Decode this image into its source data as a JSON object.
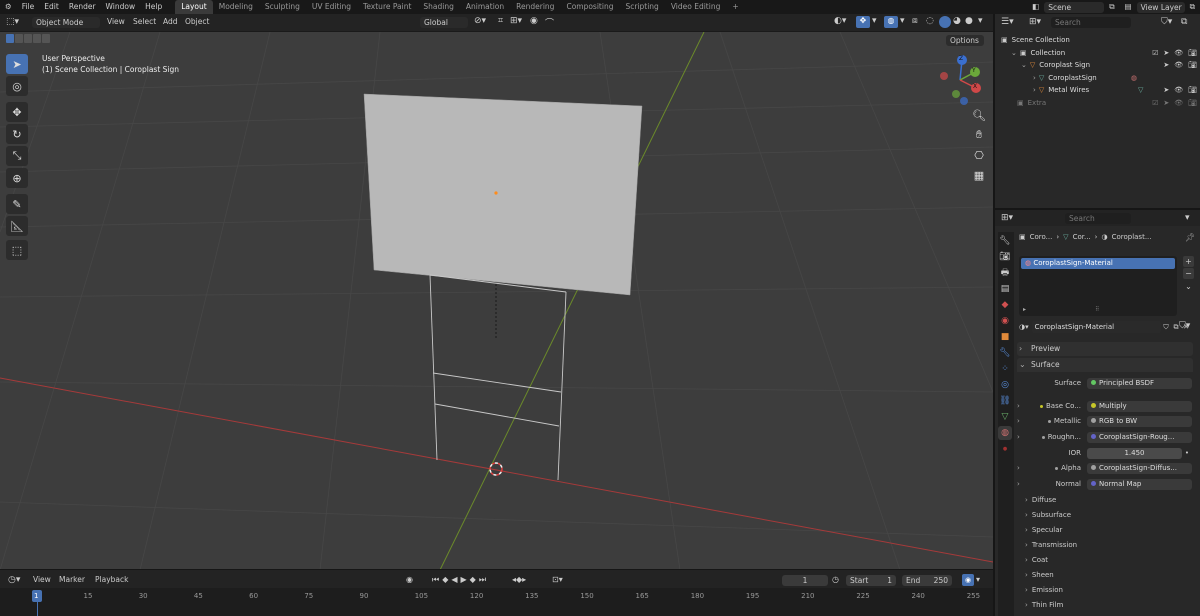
{
  "top_menu": [
    "File",
    "Edit",
    "Render",
    "Window",
    "Help"
  ],
  "workspaces": [
    "Layout",
    "Modeling",
    "Sculpting",
    "UV Editing",
    "Texture Paint",
    "Shading",
    "Animation",
    "Rendering",
    "Compositing",
    "Scripting",
    "Video Editing"
  ],
  "add_workspace": "+",
  "scene": {
    "name": "Scene",
    "view_layer": "View Layer"
  },
  "viewport_header": {
    "mode": "Object Mode",
    "menus": [
      "View",
      "Select",
      "Add",
      "Object"
    ],
    "transform": "Global",
    "options": "Options"
  },
  "viewport_info": {
    "line1": "User Perspective",
    "line2": "(1) Scene Collection | Coroplast Sign"
  },
  "gizmo": {
    "z": "Z",
    "y": "Y",
    "x": "X"
  },
  "outliner": {
    "search_placeholder": "Search",
    "scene_collection": "Scene Collection",
    "items": [
      {
        "label": "Collection",
        "indent": 1
      },
      {
        "label": "Coroplast Sign",
        "indent": 2
      },
      {
        "label": "CoroplastSign",
        "indent": 3
      },
      {
        "label": "Metal Wires",
        "indent": 3
      },
      {
        "label": "Extra",
        "indent": 1
      }
    ]
  },
  "properties": {
    "search_placeholder": "Search",
    "breadcrumb": [
      "Coro...",
      "Cor...",
      "Coroplast..."
    ],
    "material_slot": "CoroplastSign-Material",
    "material_name": "CoroplastSign-Material",
    "panels": {
      "preview": "Preview",
      "surface": "Surface",
      "diffuse": "Diffuse",
      "subsurface": "Subsurface",
      "specular": "Specular",
      "transmission": "Transmission",
      "coat": "Coat",
      "sheen": "Sheen",
      "emission": "Emission",
      "thin_film": "Thin Film"
    },
    "surface_rows": [
      {
        "label": "Surface",
        "value": "Principled BSDF",
        "color": "#63c763"
      },
      {
        "label": "Base Co...",
        "value": "Multiply",
        "color": "#c7c729"
      },
      {
        "label": "Metallic",
        "value": "RGB to BW",
        "color": "#a1a1a1"
      },
      {
        "label": "Roughn...",
        "value": "CoroplastSign-Roug...",
        "color": "#6363c7"
      },
      {
        "label": "IOR",
        "value": "1.450",
        "color": ""
      },
      {
        "label": "Alpha",
        "value": "CoroplastSign-Diffus...",
        "color": "#a1a1a1"
      },
      {
        "label": "Normal",
        "value": "Normal Map",
        "color": "#6363c7"
      }
    ]
  },
  "timeline": {
    "menus": [
      "View",
      "Marker",
      "Playback"
    ],
    "current_frame": "1",
    "start_label": "Start",
    "start": "1",
    "end_label": "End",
    "end": "250",
    "ticks": [
      "1",
      "15",
      "30",
      "45",
      "60",
      "75",
      "90",
      "105",
      "120",
      "135",
      "150",
      "165",
      "180",
      "195",
      "210",
      "225",
      "240",
      "255"
    ]
  },
  "colors": {
    "accent": "#4772b3",
    "x_axis": "#b03a3a",
    "y_axis": "#7a9a2a",
    "sign": "#b8b8b8"
  }
}
